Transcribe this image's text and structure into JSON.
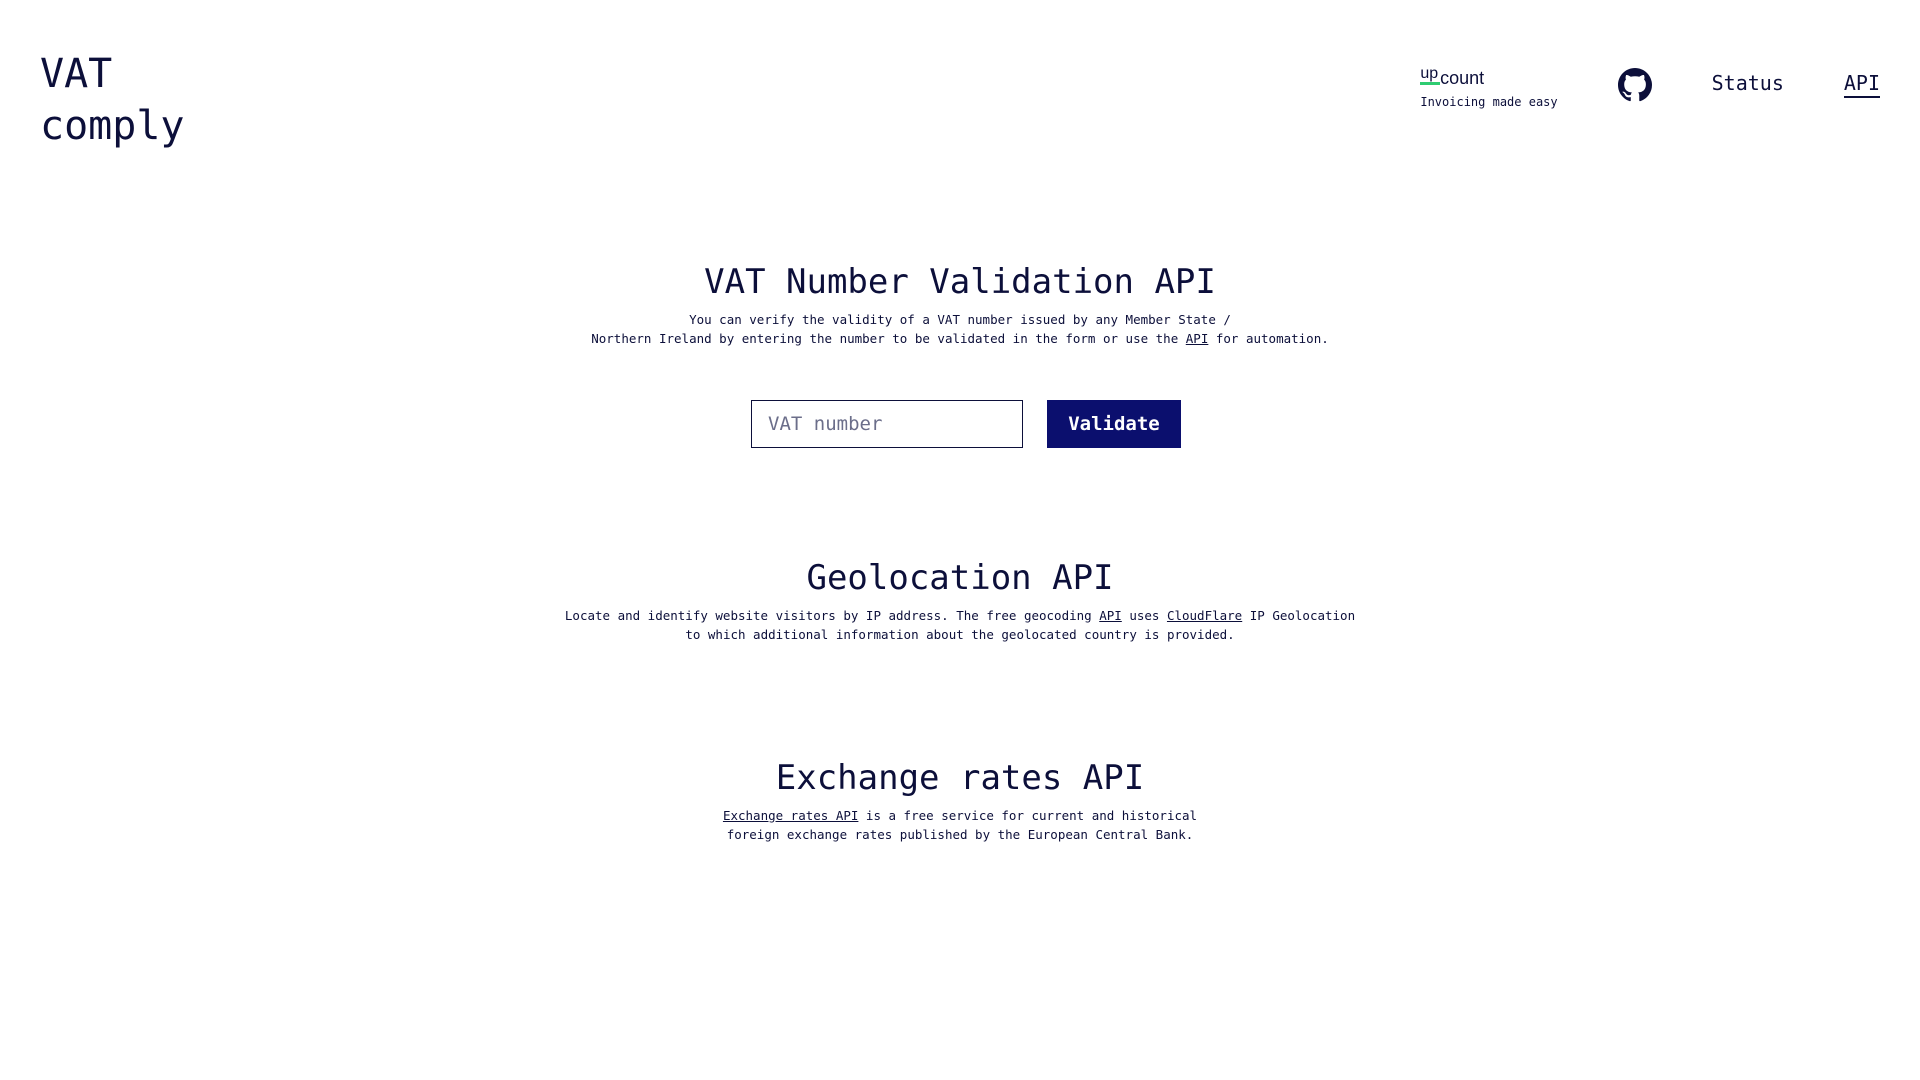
{
  "logo": {
    "line1": "VAT",
    "line2": "comply"
  },
  "nav": {
    "upcount": {
      "up": "up",
      "count": "count",
      "tagline": "Invoicing made easy"
    },
    "status": "Status",
    "api": "API"
  },
  "vat_section": {
    "title": "VAT Number Validation API",
    "desc_line1": "You can verify the validity of a VAT number issued by any Member State /",
    "desc_line2_before": "Northern Ireland by entering the number to be validated in the form or use the ",
    "desc_link": "API",
    "desc_line2_after": " for automation.",
    "input_placeholder": "VAT number",
    "button_label": "Validate"
  },
  "geo_section": {
    "title": "Geolocation API",
    "desc_line1_before": "Locate and identify website visitors by IP address. The free geocoding ",
    "desc_link_api": "API",
    "desc_mid": " uses ",
    "desc_link_cf": "CloudFlare",
    "desc_line1_after": " IP Geolocation",
    "desc_line2": "to which additional information about the geolocated country is provided."
  },
  "fx_section": {
    "title": "Exchange rates API",
    "desc_link": "Exchange rates API",
    "desc_line1_after": " is a free service for current and historical",
    "desc_line2": "foreign exchange rates published by the European Central Bank."
  },
  "colors": {
    "text": "#0c0f3a",
    "button": "#0b0f6e",
    "upcount_accent": "#2ecc71"
  }
}
